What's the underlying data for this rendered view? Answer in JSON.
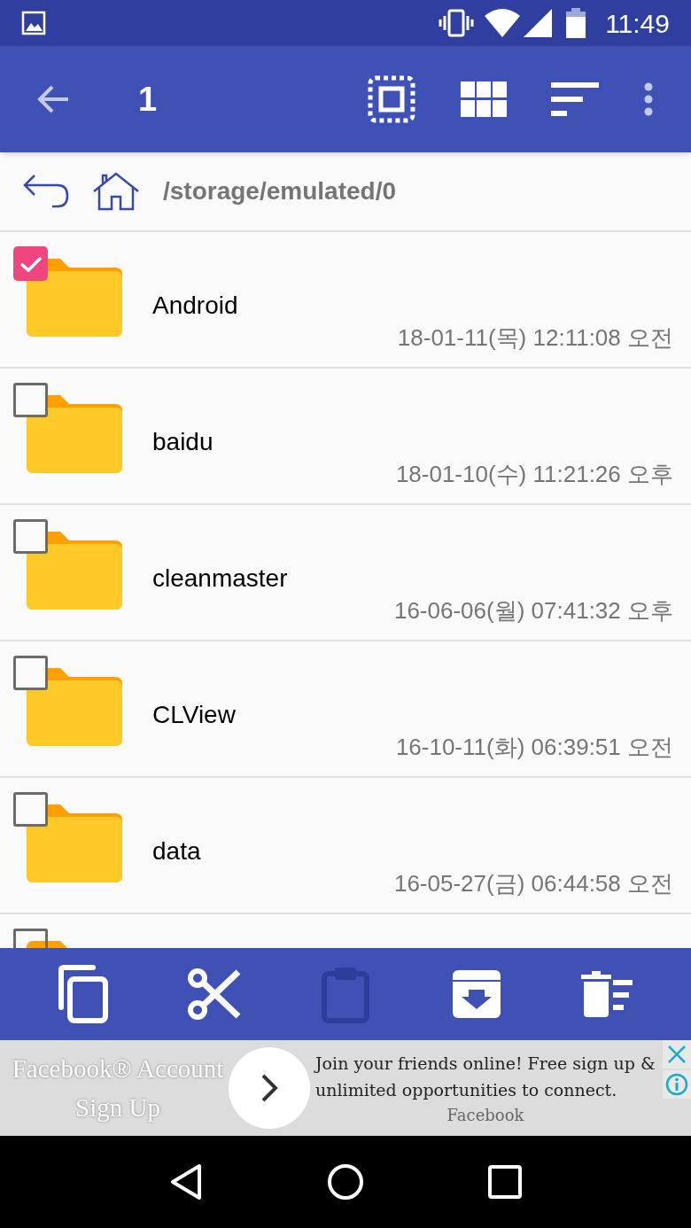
{
  "status_bar": {
    "time": "11:49"
  },
  "toolbar": {
    "title": "1"
  },
  "path_bar": {
    "path": "/storage/emulated/0"
  },
  "files": [
    {
      "name": "Android",
      "date": "18-01-11(목) 12:11:08 오전",
      "checked": true
    },
    {
      "name": "baidu",
      "date": "18-01-10(수) 11:21:26 오후",
      "checked": false
    },
    {
      "name": "cleanmaster",
      "date": "16-06-06(월) 07:41:32 오후",
      "checked": false
    },
    {
      "name": "CLView",
      "date": "16-10-11(화) 06:39:51 오전",
      "checked": false
    },
    {
      "name": "data",
      "date": "16-05-27(금) 06:44:58 오전",
      "checked": false
    },
    {
      "checked": false
    }
  ],
  "action_bar": [
    {
      "kind": "copy",
      "disabled": false
    },
    {
      "kind": "cut",
      "disabled": false
    },
    {
      "kind": "paste",
      "disabled": true
    },
    {
      "kind": "archive",
      "disabled": false
    },
    {
      "kind": "delete",
      "disabled": false
    }
  ],
  "ad": {
    "title": "Facebook® Account Sign Up",
    "body": "Join your friends online! Free sign up & unlimited opportunities to connect.",
    "advertiser": "Facebook"
  }
}
